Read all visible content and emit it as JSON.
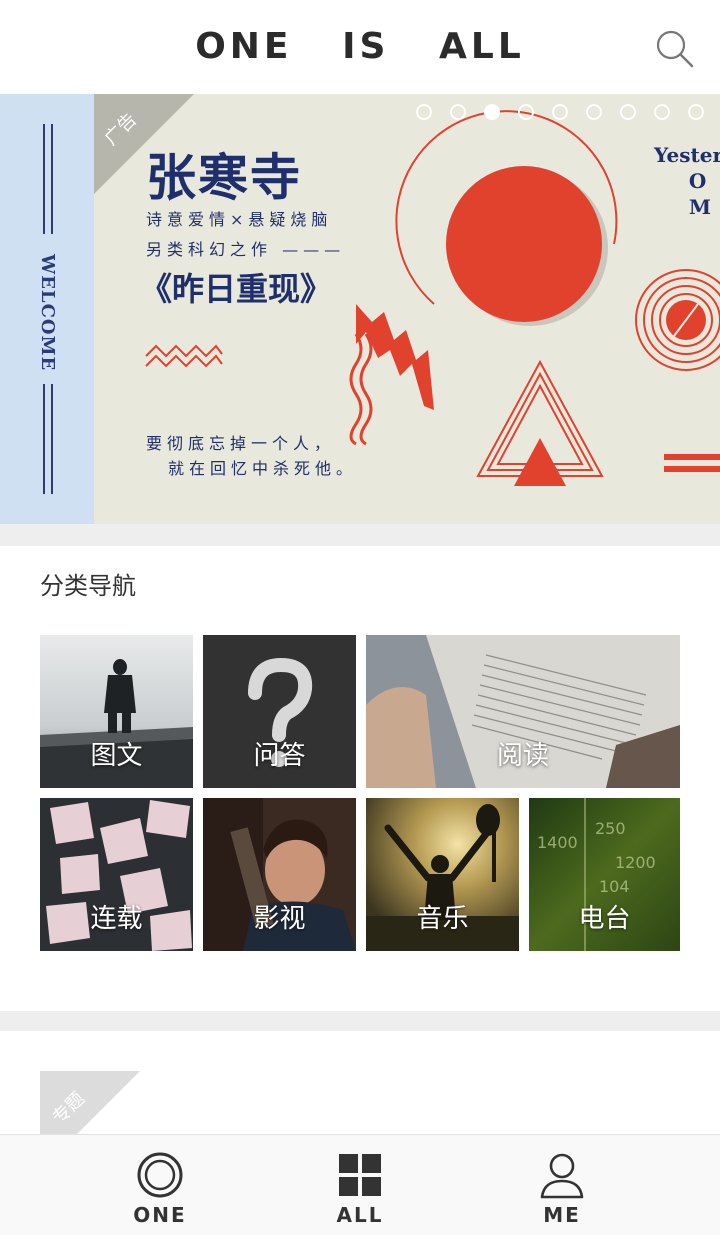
{
  "header": {
    "title": "ONE   IS   ALL",
    "search_icon": "search-icon"
  },
  "banner": {
    "ad_tag": "广告",
    "welcome": "WELCOME",
    "title": "张寒寺",
    "line1": "诗意爱情×悬疑烧脑",
    "line2": "另类科幻之作 ———",
    "book": "《昨日重现》",
    "quote1": "要彻底忘掉一个人，",
    "quote2": "就在回忆中杀死他。",
    "english_partial": "Yester\n     O\n     M",
    "slide_count": 9,
    "active_slide": 3,
    "colors": {
      "accent": "#e0422e",
      "ink": "#1f2f6b",
      "paper": "#e9e8dc",
      "strip": "#cfe0f2"
    }
  },
  "categories": {
    "title": "分类导航",
    "items": [
      {
        "label": "图文",
        "icon": "person-by-sea-photo"
      },
      {
        "label": "问答",
        "icon": "question-mark-photo"
      },
      {
        "label": "阅读",
        "icon": "open-book-photo"
      },
      {
        "label": "连载",
        "icon": "flying-papers-photo"
      },
      {
        "label": "影视",
        "icon": "boy-with-film-photo"
      },
      {
        "label": "音乐",
        "icon": "guitar-silhouette-photo"
      },
      {
        "label": "电台",
        "icon": "radio-dial-photo"
      }
    ]
  },
  "topic": {
    "tag": "专题"
  },
  "bottom_nav": {
    "items": [
      {
        "label": "ONE",
        "icon": "one-circle-icon"
      },
      {
        "label": "ALL",
        "icon": "grid-icon"
      },
      {
        "label": "ME",
        "icon": "user-icon"
      }
    ]
  }
}
